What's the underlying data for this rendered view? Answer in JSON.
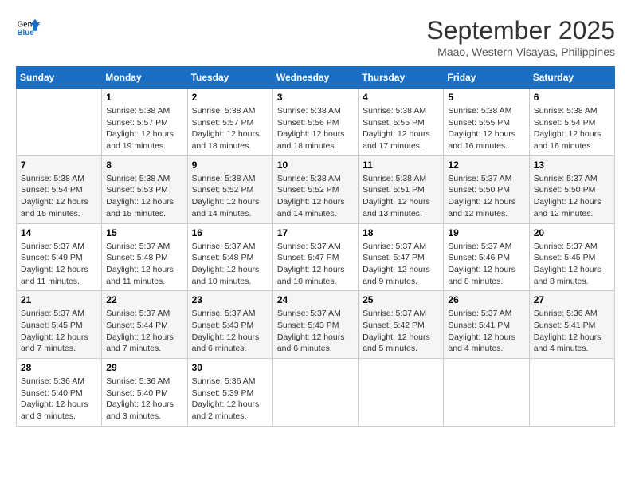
{
  "header": {
    "logo_line1": "General",
    "logo_line2": "Blue",
    "month": "September 2025",
    "location": "Maao, Western Visayas, Philippines"
  },
  "days_of_week": [
    "Sunday",
    "Monday",
    "Tuesday",
    "Wednesday",
    "Thursday",
    "Friday",
    "Saturday"
  ],
  "weeks": [
    [
      {
        "day": "",
        "info": ""
      },
      {
        "day": "1",
        "info": "Sunrise: 5:38 AM\nSunset: 5:57 PM\nDaylight: 12 hours\nand 19 minutes."
      },
      {
        "day": "2",
        "info": "Sunrise: 5:38 AM\nSunset: 5:57 PM\nDaylight: 12 hours\nand 18 minutes."
      },
      {
        "day": "3",
        "info": "Sunrise: 5:38 AM\nSunset: 5:56 PM\nDaylight: 12 hours\nand 18 minutes."
      },
      {
        "day": "4",
        "info": "Sunrise: 5:38 AM\nSunset: 5:55 PM\nDaylight: 12 hours\nand 17 minutes."
      },
      {
        "day": "5",
        "info": "Sunrise: 5:38 AM\nSunset: 5:55 PM\nDaylight: 12 hours\nand 16 minutes."
      },
      {
        "day": "6",
        "info": "Sunrise: 5:38 AM\nSunset: 5:54 PM\nDaylight: 12 hours\nand 16 minutes."
      }
    ],
    [
      {
        "day": "7",
        "info": "Sunrise: 5:38 AM\nSunset: 5:54 PM\nDaylight: 12 hours\nand 15 minutes."
      },
      {
        "day": "8",
        "info": "Sunrise: 5:38 AM\nSunset: 5:53 PM\nDaylight: 12 hours\nand 15 minutes."
      },
      {
        "day": "9",
        "info": "Sunrise: 5:38 AM\nSunset: 5:52 PM\nDaylight: 12 hours\nand 14 minutes."
      },
      {
        "day": "10",
        "info": "Sunrise: 5:38 AM\nSunset: 5:52 PM\nDaylight: 12 hours\nand 14 minutes."
      },
      {
        "day": "11",
        "info": "Sunrise: 5:38 AM\nSunset: 5:51 PM\nDaylight: 12 hours\nand 13 minutes."
      },
      {
        "day": "12",
        "info": "Sunrise: 5:37 AM\nSunset: 5:50 PM\nDaylight: 12 hours\nand 12 minutes."
      },
      {
        "day": "13",
        "info": "Sunrise: 5:37 AM\nSunset: 5:50 PM\nDaylight: 12 hours\nand 12 minutes."
      }
    ],
    [
      {
        "day": "14",
        "info": "Sunrise: 5:37 AM\nSunset: 5:49 PM\nDaylight: 12 hours\nand 11 minutes."
      },
      {
        "day": "15",
        "info": "Sunrise: 5:37 AM\nSunset: 5:48 PM\nDaylight: 12 hours\nand 11 minutes."
      },
      {
        "day": "16",
        "info": "Sunrise: 5:37 AM\nSunset: 5:48 PM\nDaylight: 12 hours\nand 10 minutes."
      },
      {
        "day": "17",
        "info": "Sunrise: 5:37 AM\nSunset: 5:47 PM\nDaylight: 12 hours\nand 10 minutes."
      },
      {
        "day": "18",
        "info": "Sunrise: 5:37 AM\nSunset: 5:47 PM\nDaylight: 12 hours\nand 9 minutes."
      },
      {
        "day": "19",
        "info": "Sunrise: 5:37 AM\nSunset: 5:46 PM\nDaylight: 12 hours\nand 8 minutes."
      },
      {
        "day": "20",
        "info": "Sunrise: 5:37 AM\nSunset: 5:45 PM\nDaylight: 12 hours\nand 8 minutes."
      }
    ],
    [
      {
        "day": "21",
        "info": "Sunrise: 5:37 AM\nSunset: 5:45 PM\nDaylight: 12 hours\nand 7 minutes."
      },
      {
        "day": "22",
        "info": "Sunrise: 5:37 AM\nSunset: 5:44 PM\nDaylight: 12 hours\nand 7 minutes."
      },
      {
        "day": "23",
        "info": "Sunrise: 5:37 AM\nSunset: 5:43 PM\nDaylight: 12 hours\nand 6 minutes."
      },
      {
        "day": "24",
        "info": "Sunrise: 5:37 AM\nSunset: 5:43 PM\nDaylight: 12 hours\nand 6 minutes."
      },
      {
        "day": "25",
        "info": "Sunrise: 5:37 AM\nSunset: 5:42 PM\nDaylight: 12 hours\nand 5 minutes."
      },
      {
        "day": "26",
        "info": "Sunrise: 5:37 AM\nSunset: 5:41 PM\nDaylight: 12 hours\nand 4 minutes."
      },
      {
        "day": "27",
        "info": "Sunrise: 5:36 AM\nSunset: 5:41 PM\nDaylight: 12 hours\nand 4 minutes."
      }
    ],
    [
      {
        "day": "28",
        "info": "Sunrise: 5:36 AM\nSunset: 5:40 PM\nDaylight: 12 hours\nand 3 minutes."
      },
      {
        "day": "29",
        "info": "Sunrise: 5:36 AM\nSunset: 5:40 PM\nDaylight: 12 hours\nand 3 minutes."
      },
      {
        "day": "30",
        "info": "Sunrise: 5:36 AM\nSunset: 5:39 PM\nDaylight: 12 hours\nand 2 minutes."
      },
      {
        "day": "",
        "info": ""
      },
      {
        "day": "",
        "info": ""
      },
      {
        "day": "",
        "info": ""
      },
      {
        "day": "",
        "info": ""
      }
    ]
  ]
}
